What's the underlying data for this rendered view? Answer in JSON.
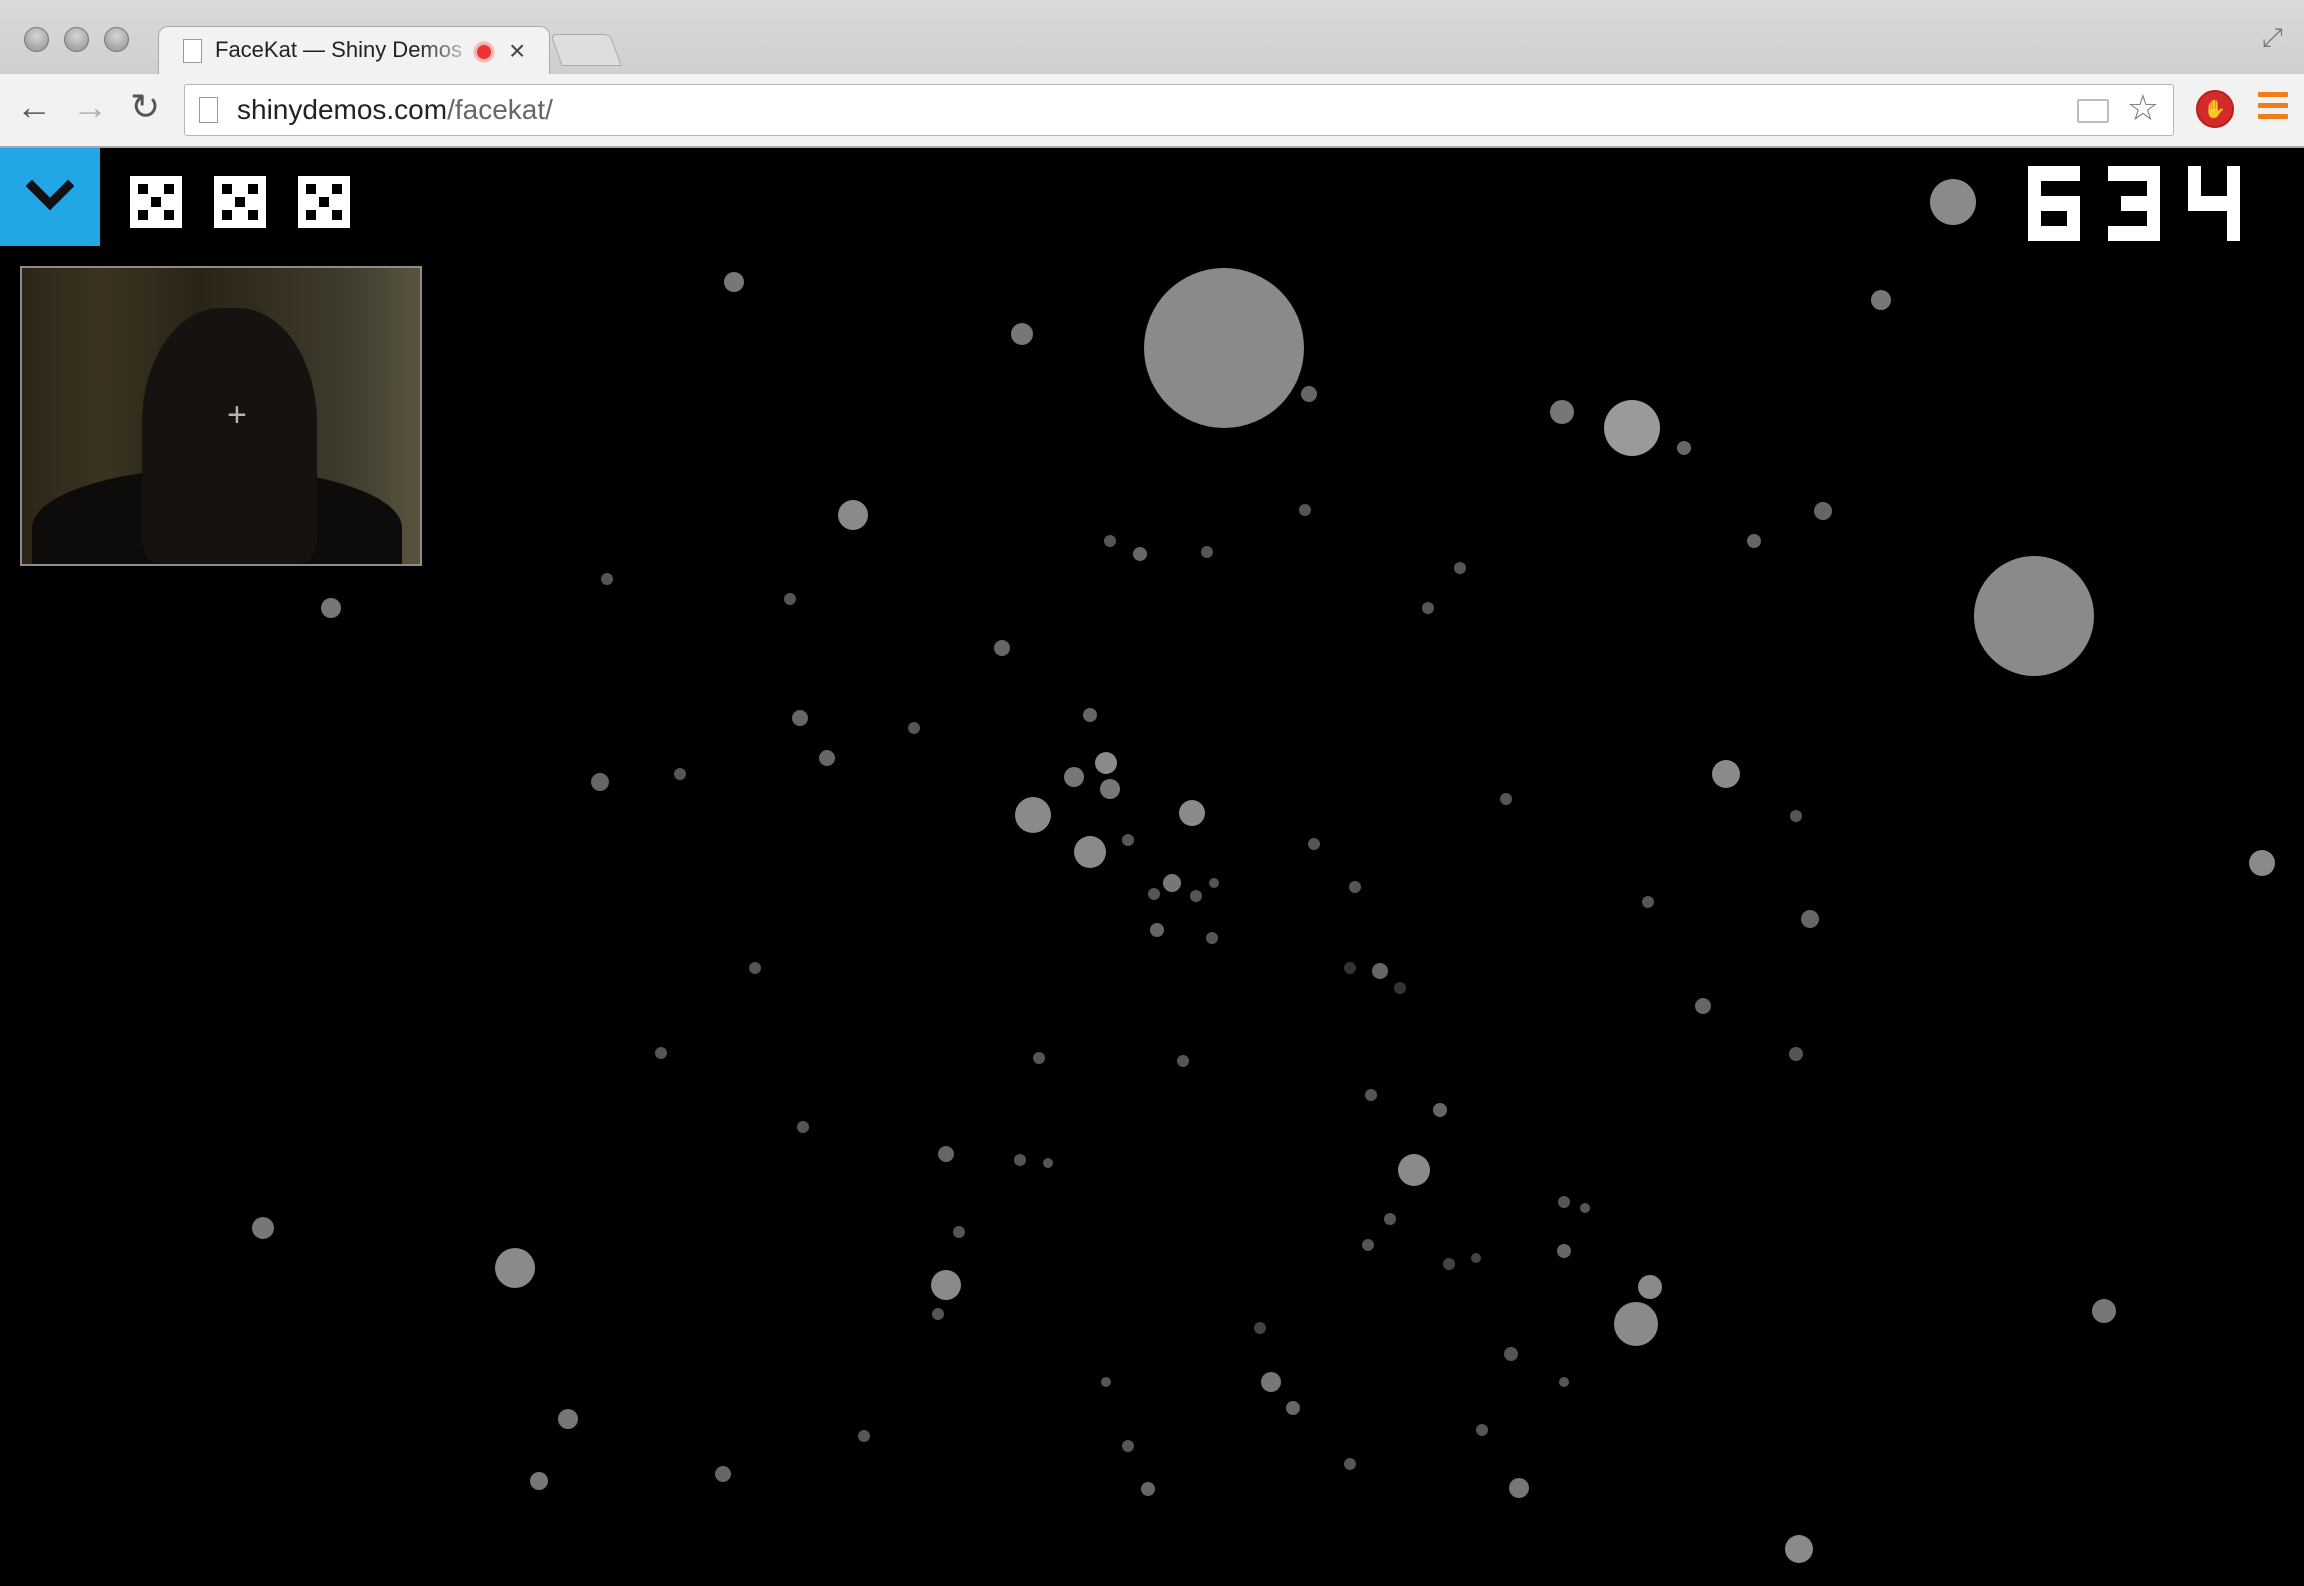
{
  "browser": {
    "tab_title": "FaceKat — Shiny Demos",
    "tab_close": "×",
    "url_host": "shinydemos.com",
    "url_path": "/facekat/",
    "back": "←",
    "forward": "→",
    "reload": "↻",
    "bookmark_star": "☆",
    "accent_menu_color": "#ef7d1a",
    "record_color": "#e33333"
  },
  "game": {
    "title": "FaceKat",
    "background_color": "#000000",
    "drawer_toggle_color": "#22a7e6",
    "lives": 3,
    "score": "634",
    "webcam_crosshair": "+",
    "ball_color": "#888888"
  }
}
